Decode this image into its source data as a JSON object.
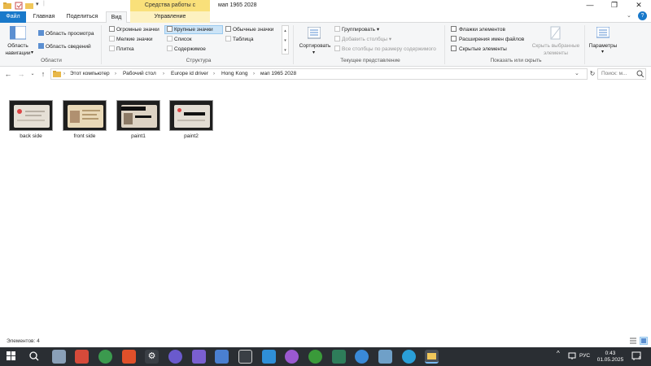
{
  "window": {
    "title": "мап 1965 2028",
    "context_tab_group": "Средства работы с рисунками",
    "controls": {
      "minimize": "—",
      "maximize": "❐",
      "close": "✕"
    }
  },
  "ribbon_tabs": [
    {
      "label": "Файл"
    },
    {
      "label": "Главная"
    },
    {
      "label": "Поделиться"
    },
    {
      "label": "Вид"
    },
    {
      "label": "Управление"
    }
  ],
  "ribbon": {
    "panes": {
      "nav_pane_line1": "Область",
      "nav_pane_line2": "навигации",
      "preview": "Область просмотра",
      "details": "Область сведений",
      "label": "Области"
    },
    "layout": {
      "items": [
        "Огромные значки",
        "Крупные значки",
        "Обычные значки",
        "Мелкие значки",
        "Список",
        "Таблица",
        "Плитка",
        "Содержимое"
      ],
      "selected": "Крупные значки",
      "label": "Структура"
    },
    "current_view": {
      "sort": "Сортировать",
      "group": "Группировать",
      "add_columns": "Добавить столбцы",
      "fit_columns": "Все столбцы по размеру содержимого",
      "label": "Текущее представление"
    },
    "show_hide": {
      "item_checkboxes": "Флажки элементов",
      "file_extensions": "Расширения имен файлов",
      "hidden_items": "Скрытые элементы",
      "hide_selected_line1": "Скрыть выбранные",
      "hide_selected_line2": "элементы",
      "label": "Показать или скрыть"
    },
    "options": "Параметры"
  },
  "breadcrumbs": [
    "Этот компьютер",
    "Рабочий стол",
    "Europe id driver",
    "Hong Kong",
    "мап 1965 2028"
  ],
  "search": {
    "placeholder": "Поиск: м..."
  },
  "files": [
    {
      "name": "back side"
    },
    {
      "name": "front side"
    },
    {
      "name": "paint1"
    },
    {
      "name": "paint2"
    }
  ],
  "status": {
    "items_count": "Элементов: 4"
  },
  "taskbar": {
    "language": "РУС",
    "time": "0:43",
    "date": "01.05.2025",
    "notifications": "4"
  }
}
